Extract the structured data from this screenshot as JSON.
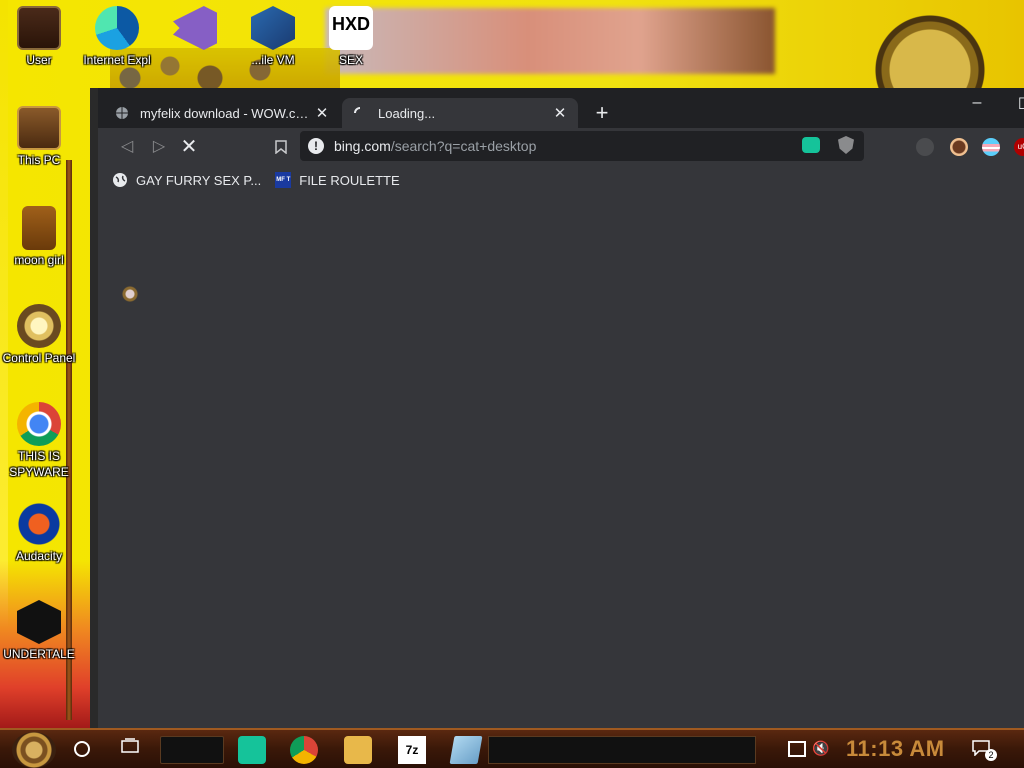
{
  "desktop": {
    "icons": [
      {
        "label": "User",
        "icon": "steampunk-folder-icon"
      },
      {
        "label": "Internet Expl",
        "icon": "edge-icon"
      },
      {
        "label": "",
        "icon": "visual-studio-icon"
      },
      {
        "label": "...ile VM",
        "icon": "virtualbox-icon"
      },
      {
        "label": "SEX",
        "icon": "hxd-icon"
      },
      {
        "label": "This PC",
        "icon": "steampunk-computer-icon"
      },
      {
        "label": "moon girl",
        "icon": "steampunk-box-icon"
      },
      {
        "label": "Control Panel",
        "icon": "lightbulb-icon"
      },
      {
        "label": "THIS IS SPYWARE",
        "icon": "chrome-icon"
      },
      {
        "label": "Audacity",
        "icon": "audacity-icon"
      },
      {
        "label": "UNDERTALE",
        "icon": "unity-icon"
      }
    ]
  },
  "browser": {
    "tabs": [
      {
        "title": "myfelix download - WOW.com - ",
        "favicon": "globe-icon",
        "active": false
      },
      {
        "title": "Loading...",
        "favicon": "loading-spinner-icon",
        "active": true
      }
    ],
    "new_tab_label": "+",
    "window_controls": {
      "minimize": "–",
      "maximize": "☐"
    },
    "toolbar": {
      "back": "◁",
      "forward": "▷",
      "stop": "✕",
      "bookmark": "🔖"
    },
    "omnibox": {
      "host": "bing.com",
      "path": "/search?q=cat+desktop",
      "info_icon": "!"
    },
    "bookmarks": [
      {
        "label": "GAY FURRY SEX P...",
        "icon": "globe-icon"
      },
      {
        "label": "FILE ROULETTE",
        "icon": "mft-icon",
        "icon_text": "MF T"
      }
    ]
  },
  "taskbar": {
    "clock": "11:13 AM",
    "notification_count": "2",
    "apps": [
      {
        "name": "grammarly",
        "icon": "grammarly-icon"
      },
      {
        "name": "chrome",
        "icon": "chrome-icon"
      },
      {
        "name": "file-explorer",
        "icon": "folder-icon"
      },
      {
        "name": "7zip",
        "label": "7z",
        "icon": "7zip-icon"
      },
      {
        "name": "app5",
        "icon": "notepad-icon"
      }
    ]
  },
  "colors": {
    "browser_bg": "#35363a",
    "titlebar_bg": "#202124",
    "desktop_yellow": "#f5e600",
    "clock_color": "#c88a3a"
  }
}
